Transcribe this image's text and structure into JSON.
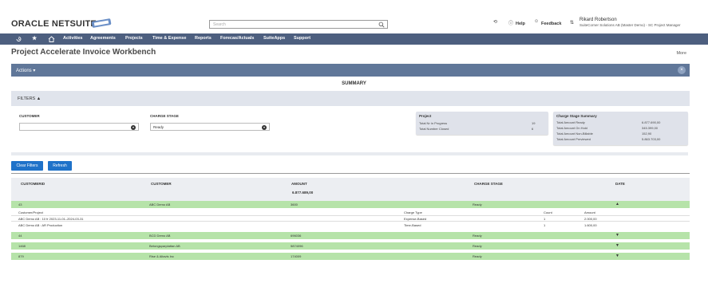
{
  "header": {
    "logo_oracle": "ORACLE",
    "logo_netsuite": "NETSUITE",
    "search_placeholder": "Search",
    "help_label": "Help",
    "feedback_label": "Feedback",
    "user_name": "Rikard Robertson",
    "user_role": "SuiteCorner Solutions AB (Master Demo) - SC Project Manager"
  },
  "nav": {
    "items": [
      "Activities",
      "Agreements",
      "Projects",
      "Time & Expense",
      "Reports",
      "Forecas/Actuals",
      "SuiteApps",
      "Support"
    ]
  },
  "page": {
    "title": "Project Accelerate Invoice Workbench",
    "more": "More",
    "actions": "Actions",
    "summary": "SUMMARY",
    "filters": "FILTERS"
  },
  "filters": {
    "customer_label": "CUSTOMER",
    "customer_value": "",
    "charge_stage_label": "CHARGE STAGE",
    "charge_stage_value": "Ready"
  },
  "project_card": {
    "title": "Project",
    "rows": [
      {
        "label": "Total Nr in Progress",
        "value": "19"
      },
      {
        "label": "Total Number Closed",
        "value": "6"
      }
    ]
  },
  "charge_card": {
    "title": "Charge Stage Summary",
    "rows": [
      {
        "label": "Total Amount Ready",
        "value": "6.877.690,00"
      },
      {
        "label": "Total Amount On Hold",
        "value": "345.399,00"
      },
      {
        "label": "Total Amount Non-Billable",
        "value": "152,90"
      },
      {
        "label": "Total Amount Previewed",
        "value": "5.863.703,00"
      }
    ]
  },
  "buttons": {
    "clear": "Clear Filters",
    "refresh": "Refresh"
  },
  "table": {
    "columns": [
      "CUSTOMERID",
      "CUSTOMER",
      "AMOUNT",
      "CHARGE STAGE",
      "DATE"
    ],
    "total_amount": "6.877.689,00",
    "rows": [
      {
        "id": "43",
        "customer": "ABC Demo AB",
        "amount": "3600",
        "stage": "Ready",
        "expanded": true
      },
      {
        "id": "44",
        "customer": "BCD Demo AB",
        "amount": "696036",
        "stage": "Ready",
        "expanded": false
      },
      {
        "id": "1468",
        "customer": "Betongsparplattan AB",
        "amount": "5874096",
        "stage": "Ready",
        "expanded": false
      },
      {
        "id": "879",
        "customer": "Rise & Altavis Inc",
        "amount": "174009",
        "stage": "Ready",
        "expanded": false
      }
    ],
    "detail_columns": [
      "Customer/Project",
      "Charge Type",
      "Count",
      "Amount"
    ],
    "detail_rows": [
      {
        "project": "ABC Demo AB : 10 fr 2023-11-01–2024-03-31",
        "type": "Expense-Based",
        "count": "1",
        "amount": "2.000,00"
      },
      {
        "project": "ABC Demo AB : AR Production",
        "type": "Time-Based",
        "count": "1",
        "amount": "1.600,00"
      }
    ]
  }
}
